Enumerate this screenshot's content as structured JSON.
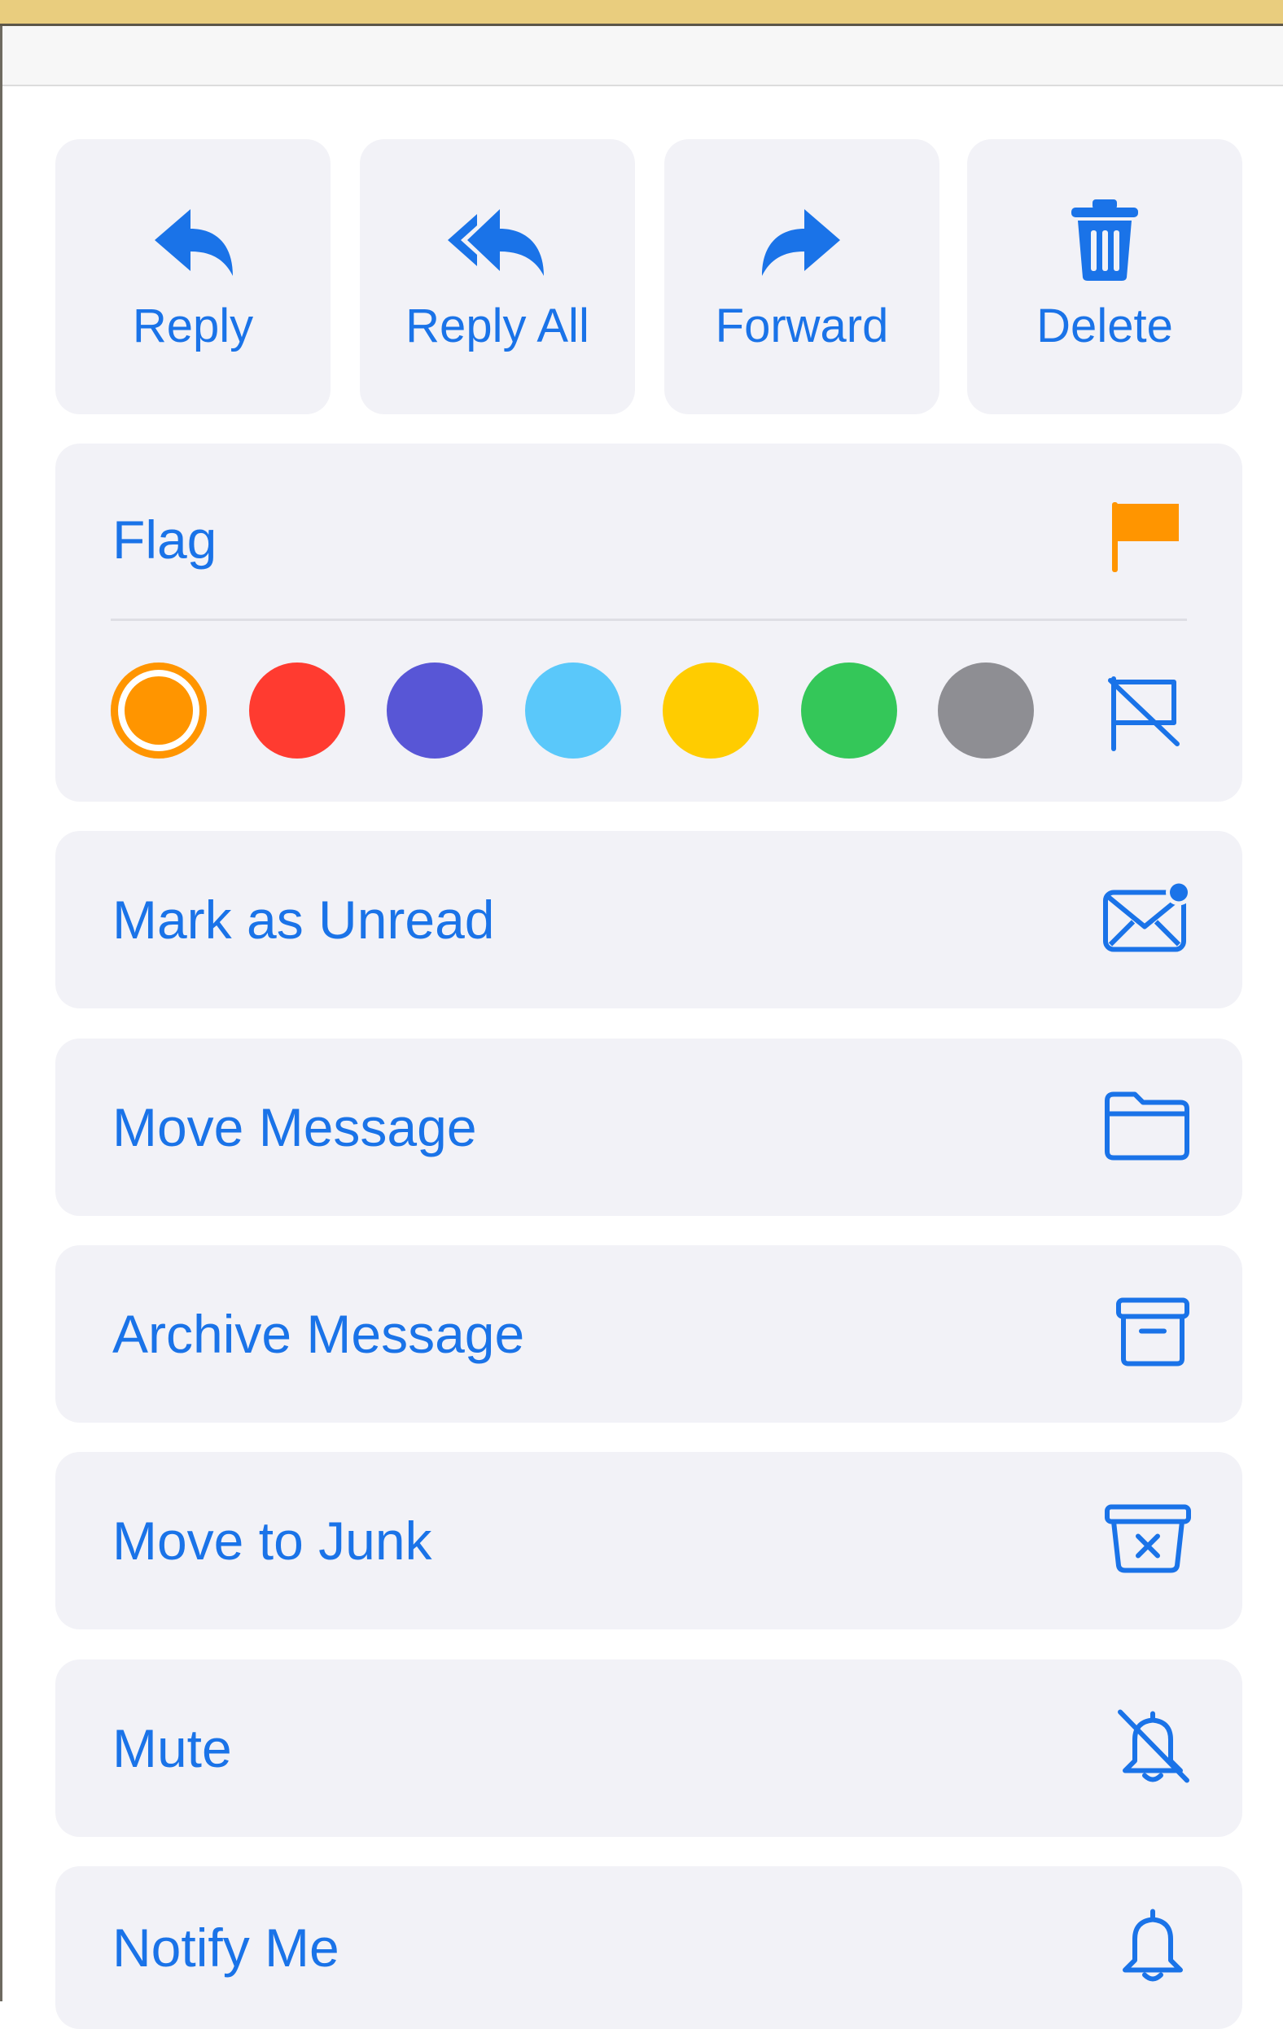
{
  "actions": {
    "reply": "Reply",
    "reply_all": "Reply All",
    "forward": "Forward",
    "delete": "Delete"
  },
  "flag": {
    "label": "Flag",
    "colors": [
      "#ff9500",
      "#ff3b30",
      "#5856d6",
      "#5ac8fa",
      "#ffcc00",
      "#34c759",
      "#8e8e93"
    ],
    "selected_color": "#ff9500"
  },
  "menu": {
    "mark_unread": "Mark as Unread",
    "move_message": "Move Message",
    "archive_message": "Archive Message",
    "move_to_junk": "Move to Junk",
    "mute": "Mute",
    "notify_me": "Notify Me"
  },
  "theme": {
    "accent": "#1a73e8",
    "card_bg": "#f2f2f7",
    "flag_color": "#ff9500"
  }
}
